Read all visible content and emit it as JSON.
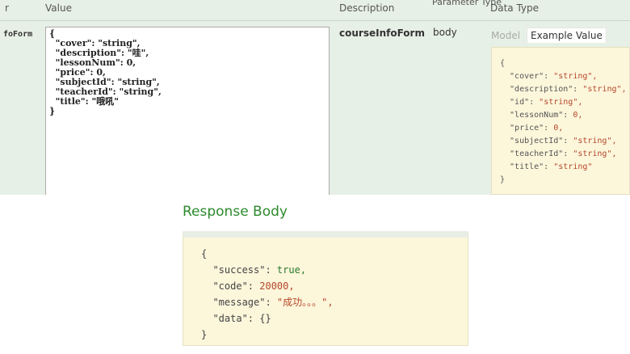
{
  "params_table": {
    "headers": {
      "parameter": "r",
      "value": "Value",
      "description": "Description",
      "parameter_type": "Parameter Type",
      "data_type": "Data Type"
    },
    "row": {
      "name": "foForm",
      "value_text": "{\n  \"cover\": \"string\",\n  \"description\": \"哇\",\n  \"lessonNum\": 0,\n  \"price\": 0,\n  \"subjectId\": \"string\",\n  \"teacherId\": \"string\",\n  \"title\": \"哦吼\"\n}",
      "description": "courseInfoForm",
      "parameter_type": "body",
      "tabs": {
        "model": "Model",
        "example": "Example Value"
      },
      "example_lines": [
        {
          "k": "{",
          "v": ""
        },
        {
          "k": "  \"cover\": ",
          "v": "\"string\","
        },
        {
          "k": "  \"description\": ",
          "v": "\"string\","
        },
        {
          "k": "  \"id\": ",
          "v": "\"string\","
        },
        {
          "k": "  \"lessonNum\": ",
          "v": "0,"
        },
        {
          "k": "  \"price\": ",
          "v": "0,"
        },
        {
          "k": "  \"subjectId\": ",
          "v": "\"string\","
        },
        {
          "k": "  \"teacherId\": ",
          "v": "\"string\","
        },
        {
          "k": "  \"title\": ",
          "v": "\"string\""
        },
        {
          "k": "}",
          "v": ""
        }
      ]
    }
  },
  "response": {
    "title": "Response Body",
    "lines": [
      {
        "k": "{",
        "v": "",
        "cls": ""
      },
      {
        "k": "  \"success\": ",
        "v": "true,",
        "cls": "bool"
      },
      {
        "k": "  \"code\": ",
        "v": "20000,",
        "cls": "num"
      },
      {
        "k": "  \"message\": ",
        "v": "\"成功。。。\",",
        "cls": "str"
      },
      {
        "k": "  \"data\": {}",
        "v": "",
        "cls": ""
      },
      {
        "k": "}",
        "v": "",
        "cls": ""
      }
    ]
  }
}
